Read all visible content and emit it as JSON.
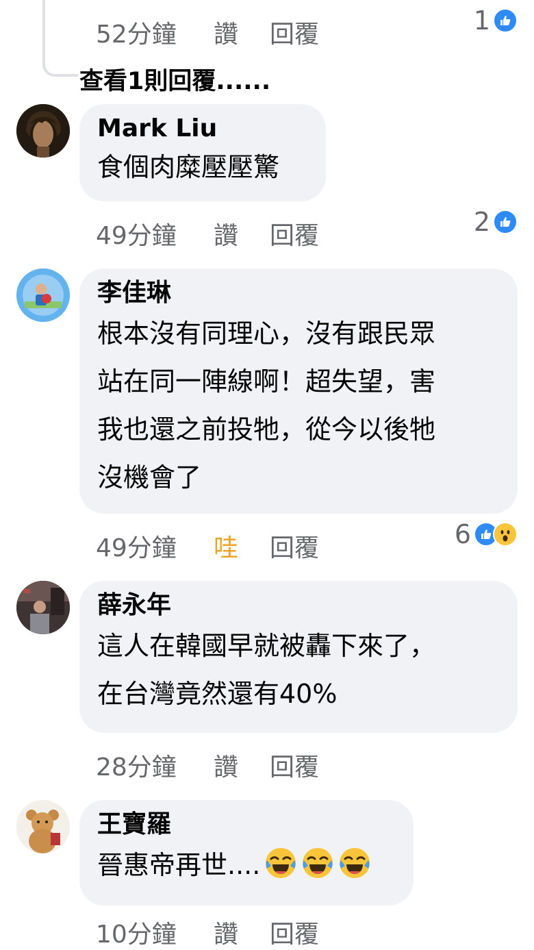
{
  "comments": [
    {
      "time": "52分鐘",
      "like": "讚",
      "reply": "回覆",
      "reactions": "1",
      "view_replies": "查看1則回覆......"
    },
    {
      "name": "Mark Liu",
      "text": "食個肉糜壓壓驚",
      "time": "49分鐘",
      "like": "讚",
      "reply": "回覆",
      "reactions": "2"
    },
    {
      "name": "李佳琳",
      "text": "根本沒有同理心，沒有跟民眾\n站在同一陣線啊！超失望，害\n我也還之前投牠，從今以後牠\n沒機會了",
      "time": "49分鐘",
      "like": "哇",
      "reply": "回覆",
      "reactions": "6"
    },
    {
      "name": "薛永年",
      "text": "這人在韓國早就被轟下來了，\n在台灣竟然還有40%",
      "time": "28分鐘",
      "like": "讚",
      "reply": "回覆"
    },
    {
      "name": "王寶羅",
      "text": "晉惠帝再世....",
      "time": "10分鐘",
      "like": "讚",
      "reply": "回覆"
    }
  ],
  "colors": {
    "bubble": "#f0f2f5",
    "meta": "#65676b",
    "like": "#2e8af5",
    "wow": "#e9a526"
  },
  "icons": [
    "like-icon",
    "wow-icon",
    "laughing-crying-emoji"
  ]
}
